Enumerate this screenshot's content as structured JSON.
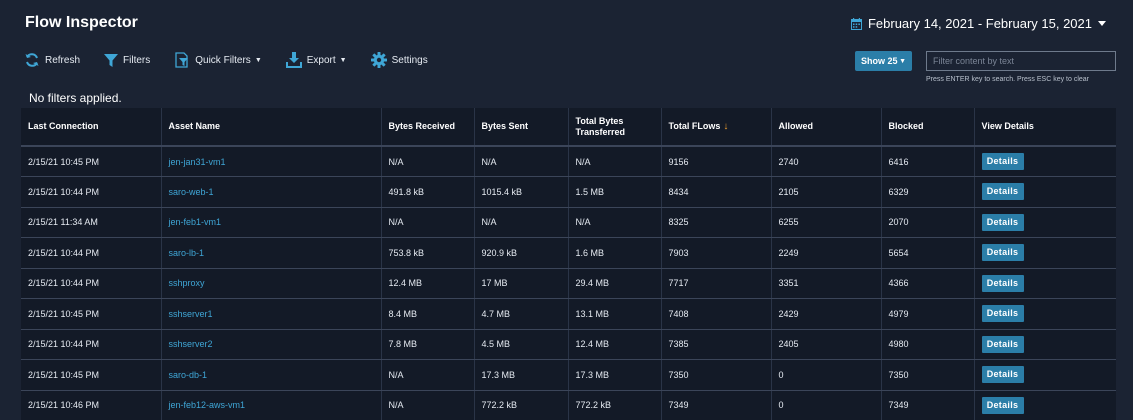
{
  "page": {
    "title": "Flow Inspector",
    "date_range": "February 14, 2021 - February 15, 2021"
  },
  "toolbar": {
    "refresh": "Refresh",
    "filters": "Filters",
    "quick_filters": "Quick Filters",
    "export": "Export",
    "settings": "Settings"
  },
  "show_select": {
    "value": "Show 25"
  },
  "search": {
    "placeholder": "Filter content by text",
    "hint": "Press ENTER key to search. Press ESC key to clear"
  },
  "filter_status": "No filters applied.",
  "table": {
    "headers": {
      "last_connection": "Last Connection",
      "asset_name": "Asset Name",
      "bytes_received": "Bytes Received",
      "bytes_sent": "Bytes Sent",
      "total_bytes_l1": "Total Bytes",
      "total_bytes_l2": "Transferred",
      "total_flows": "Total FLows",
      "allowed": "Allowed",
      "blocked": "Blocked",
      "view_details": "View Details"
    },
    "details_label": "Details",
    "rows": [
      [
        "2/15/21 10:45 PM",
        "jen-jan31-vm1",
        "N/A",
        "N/A",
        "N/A",
        "9156",
        "2740",
        "6416"
      ],
      [
        "2/15/21 10:44 PM",
        "saro-web-1",
        "491.8 kB",
        "1015.4 kB",
        "1.5 MB",
        "8434",
        "2105",
        "6329"
      ],
      [
        "2/15/21 11:34 AM",
        "jen-feb1-vm1",
        "N/A",
        "N/A",
        "N/A",
        "8325",
        "6255",
        "2070"
      ],
      [
        "2/15/21 10:44 PM",
        "saro-lb-1",
        "753.8 kB",
        "920.9 kB",
        "1.6 MB",
        "7903",
        "2249",
        "5654"
      ],
      [
        "2/15/21 10:44 PM",
        "sshproxy",
        "12.4 MB",
        "17 MB",
        "29.4 MB",
        "7717",
        "3351",
        "4366"
      ],
      [
        "2/15/21 10:45 PM",
        "sshserver1",
        "8.4 MB",
        "4.7 MB",
        "13.1 MB",
        "7408",
        "2429",
        "4979"
      ],
      [
        "2/15/21 10:44 PM",
        "sshserver2",
        "7.8 MB",
        "4.5 MB",
        "12.4 MB",
        "7385",
        "2405",
        "4980"
      ],
      [
        "2/15/21 10:45 PM",
        "saro-db-1",
        "N/A",
        "17.3 MB",
        "17.3 MB",
        "7350",
        "0",
        "7350"
      ],
      [
        "2/15/21 10:46 PM",
        "jen-feb12-aws-vm1",
        "N/A",
        "772.2 kB",
        "772.2 kB",
        "7349",
        "0",
        "7349"
      ]
    ]
  },
  "colors": {
    "background": "#1b2333",
    "table_background": "#131a27",
    "accent": "#2b7ea8",
    "link": "#3fa6d6",
    "sort_arrow": "#f0a030"
  }
}
